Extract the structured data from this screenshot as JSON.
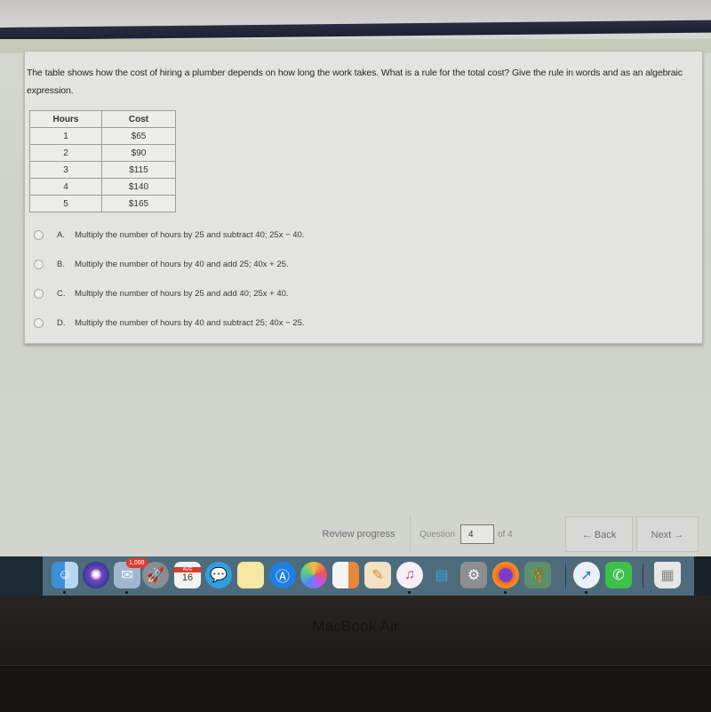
{
  "question": {
    "text": "The table shows how the cost of hiring a plumber depends on how long the work takes. What is a rule for the total cost? Give the rule in words and as an algebraic expression.",
    "table": {
      "headers": [
        "Hours",
        "Cost"
      ],
      "rows": [
        [
          "1",
          "$65"
        ],
        [
          "2",
          "$90"
        ],
        [
          "3",
          "$115"
        ],
        [
          "4",
          "$140"
        ],
        [
          "5",
          "$165"
        ]
      ]
    },
    "choices": [
      {
        "letter": "A.",
        "text": "Multiply the number of hours by 25 and subtract 40; 25x − 40."
      },
      {
        "letter": "B.",
        "text": "Multiply the number of hours by 40 and add 25; 40x + 25."
      },
      {
        "letter": "C.",
        "text": "Multiply the number of hours by 25 and add 40; 25x + 40."
      },
      {
        "letter": "D.",
        "text": "Multiply the number of hours by 40 and subtract 25; 40x − 25."
      }
    ]
  },
  "footer": {
    "review_label": "Review progress",
    "question_label": "Question",
    "question_value": "4",
    "of_label": "of 4",
    "back_label": "← Back",
    "next_label": "Next →"
  },
  "dock": {
    "mail_badge": "1,098",
    "calendar_month": "AUG",
    "calendar_day": "16",
    "apps": [
      "finder-icon",
      "siri-icon",
      "mail-icon",
      "launchpad-icon",
      "calendar-icon",
      "messages-icon",
      "notes-icon",
      "app-store-icon",
      "photos-icon",
      "news-icon",
      "pages-icon",
      "itunes-icon",
      "keynote-icon",
      "system-preferences-icon",
      "firefox-icon",
      "iphoto-icon",
      "safari-icon",
      "facetime-icon",
      "trash-icon"
    ]
  },
  "hardware": {
    "brand": "MacBook Air"
  }
}
